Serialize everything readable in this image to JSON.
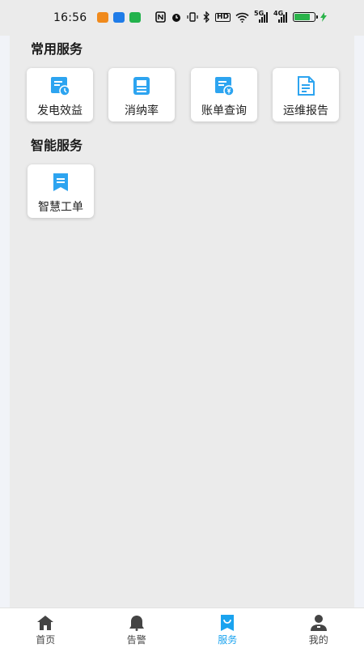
{
  "status_bar": {
    "time": "16:56",
    "signal_5g": "5G",
    "signal_4g": "4G",
    "hd_badge": "HD",
    "battery_level": 0.8,
    "colors": {
      "battery": "#2ab34a"
    }
  },
  "sections": [
    {
      "title": "常用服务",
      "items": [
        {
          "label": "发电效益",
          "icon": "revenue-doc-icon"
        },
        {
          "label": "消纳率",
          "icon": "monitor-doc-icon"
        },
        {
          "label": "账单查询",
          "icon": "bill-query-icon"
        },
        {
          "label": "运维报告",
          "icon": "report-doc-icon"
        }
      ]
    },
    {
      "title": "智能服务",
      "items": [
        {
          "label": "智慧工单",
          "icon": "bookmark-ticket-icon"
        }
      ]
    }
  ],
  "tabbar": {
    "tabs": [
      {
        "label": "首页",
        "icon": "home-icon"
      },
      {
        "label": "告警",
        "icon": "bell-icon"
      },
      {
        "label": "服务",
        "icon": "service-bookmark-icon",
        "active": true
      },
      {
        "label": "我的",
        "icon": "profile-icon"
      }
    ]
  },
  "colors": {
    "accent": "#1aa3ef",
    "icon_blue": "#2da4f0"
  }
}
